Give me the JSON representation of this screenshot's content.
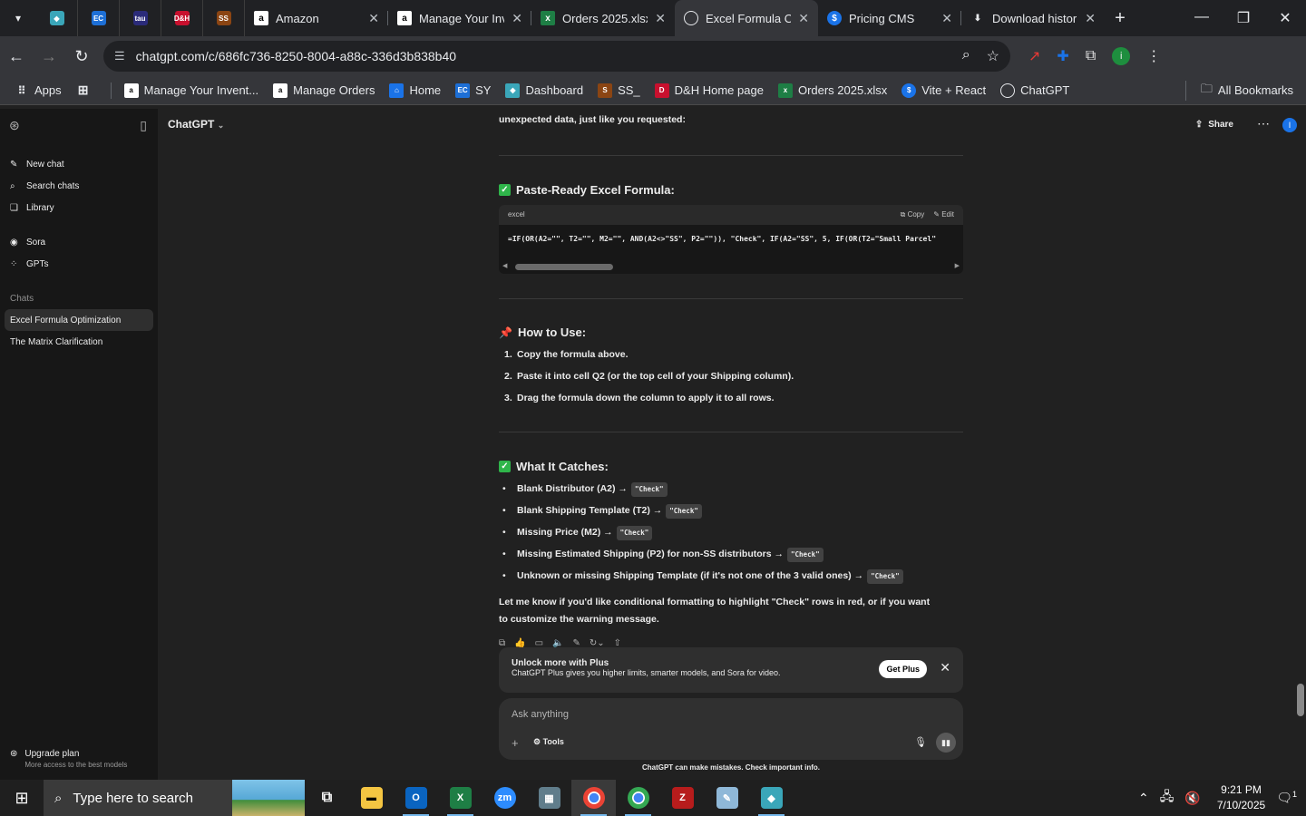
{
  "browser": {
    "tabs": [
      {
        "title": "Amazon",
        "icon": "amazon-icon"
      },
      {
        "title": "Manage Your Inv",
        "icon": "amazon-icon"
      },
      {
        "title": "Orders 2025.xlsx",
        "icon": "excel-icon"
      },
      {
        "title": "Excel Formula Op",
        "icon": "chatgpt-icon",
        "active": true
      },
      {
        "title": "Pricing CMS",
        "icon": "dollar-icon"
      },
      {
        "title": "Download histor",
        "icon": "download-icon"
      }
    ],
    "pinned": [
      {
        "label": "EC",
        "color": "#1d6fd6"
      },
      {
        "label": "tau",
        "color": "#2b2b7a"
      },
      {
        "label": "D&H",
        "color": "#c8102e"
      },
      {
        "label": "SS",
        "color": "#8b4513"
      }
    ],
    "url": "chatgpt.com/c/686fc736-8250-8004-a88c-336d3b838b40",
    "bookmarks": [
      "Apps",
      "Manage Your Invent...",
      "Manage Orders",
      "Home",
      "SY",
      "Dashboard",
      "SS_",
      "D&H Home page",
      "Orders 2025.xlsx",
      "Vite + React",
      "ChatGPT"
    ],
    "all_bookmarks": "All Bookmarks"
  },
  "sidebar": {
    "new_chat": "New chat",
    "search": "Search chats",
    "library": "Library",
    "sora": "Sora",
    "gpts": "GPTs",
    "chats_label": "Chats",
    "chats": [
      "Excel Formula Optimization",
      "The Matrix Clarification"
    ],
    "upgrade_title": "Upgrade plan",
    "upgrade_sub": "More access to the best models"
  },
  "header": {
    "model": "ChatGPT",
    "share": "Share",
    "avatar": "I"
  },
  "content": {
    "intro": "unexpected data, just like you requested:",
    "paste_title": "Paste-Ready Excel Formula:",
    "code_lang": "excel",
    "copy": "Copy",
    "edit": "Edit",
    "code": "=IF(OR(A2=\"\", T2=\"\", M2=\"\", AND(A2<>\"SS\", P2=\"\")), \"Check\", IF(A2=\"SS\", 5, IF(OR(T2=\"Small Parcel\"",
    "howto_title": "How to Use:",
    "steps": [
      {
        "n": "1.",
        "t": "Copy the formula above."
      },
      {
        "n": "2.",
        "pre": "Paste it into cell ",
        "b": "Q2",
        "post": " (or the top cell of your Shipping column)."
      },
      {
        "n": "3.",
        "t": "Drag the formula down the column to apply it to all rows."
      }
    ],
    "catches_title": "What It Catches:",
    "catches": [
      {
        "b": "Blank Distributor (A2)",
        "post": " →",
        "pill": "\"Check\""
      },
      {
        "b": "Blank Shipping Template (T2)",
        "post": " →",
        "pill": "\"Check\""
      },
      {
        "b": "Missing Price (M2)",
        "post": " →",
        "pill": "\"Check\""
      },
      {
        "b": "Missing Estimated Shipping (P2)",
        "post": " for non-SS distributors →",
        "pill": "\"Check\""
      },
      {
        "b": "Unknown or missing Shipping Template",
        "post": " (if it's not one of the 3 valid ones) →",
        "pill": "\"Check\""
      }
    ],
    "closing_pre": "Let me know if you'd like conditional formatting to ",
    "closing_b": "highlight \"Check\" rows in red",
    "closing_post": ", or if you want to customize the warning message."
  },
  "banner": {
    "title": "Unlock more with Plus",
    "sub": "ChatGPT Plus gives you higher limits, smarter models, and Sora for video.",
    "button": "Get Plus"
  },
  "composer": {
    "placeholder": "Ask anything",
    "tools": "Tools"
  },
  "disclaimer": "ChatGPT can make mistakes. Check important info.",
  "taskbar": {
    "search_placeholder": "Type here to search",
    "time": "9:21 PM",
    "date": "7/10/2025",
    "notif_count": "1"
  }
}
